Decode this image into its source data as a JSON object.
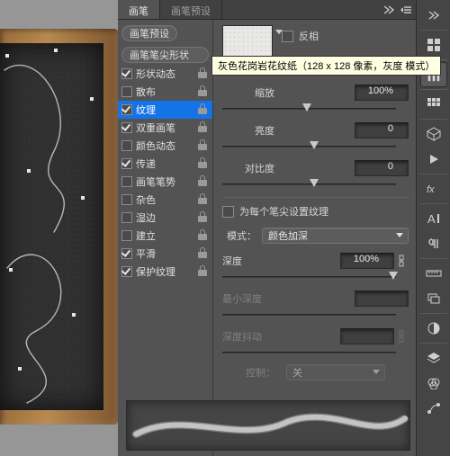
{
  "tabs": {
    "brush": "画笔",
    "presets": "画笔预设"
  },
  "checklist": {
    "preset_btn": "画笔预设",
    "tip_shape": "画笔笔尖形状",
    "items": [
      {
        "label": "形状动态",
        "checked": true,
        "locked": true
      },
      {
        "label": "散布",
        "checked": false,
        "locked": true
      },
      {
        "label": "纹理",
        "checked": true,
        "locked": true,
        "selected": true
      },
      {
        "label": "双重画笔",
        "checked": true,
        "locked": true
      },
      {
        "label": "颜色动态",
        "checked": false,
        "locked": true
      },
      {
        "label": "传递",
        "checked": true,
        "locked": true
      },
      {
        "label": "画笔笔势",
        "checked": false,
        "locked": true
      },
      {
        "label": "杂色",
        "checked": false,
        "locked": true
      },
      {
        "label": "湿边",
        "checked": false,
        "locked": true
      },
      {
        "label": "建立",
        "checked": false,
        "locked": true
      },
      {
        "label": "平滑",
        "checked": true,
        "locked": true
      },
      {
        "label": "保护纹理",
        "checked": true,
        "locked": true
      }
    ]
  },
  "texture": {
    "invert_label": "反相",
    "invert": false,
    "tooltip": "灰色花岗岩花纹纸（128 x 128 像素，灰度 模式）",
    "scale_label": "缩放",
    "scale_value": "100%",
    "brightness_label": "亮度",
    "brightness_value": "0",
    "contrast_label": "对比度",
    "contrast_value": "0",
    "each_tip_label": "为每个笔尖设置纹理",
    "each_tip": false,
    "mode_label": "模式：",
    "mode_value": "颜色加深",
    "depth_label": "深度",
    "depth_value": "100%",
    "min_depth_label": "最小深度",
    "depth_jitter_label": "深度抖动",
    "control_label": "控制：",
    "control_value": "关"
  },
  "rail_icons": [
    "grid",
    "brushes",
    "swatches",
    "cube",
    "play",
    "fx",
    "char-a",
    "paragraph",
    "measure",
    "layers-sm",
    "adjust",
    "layers",
    "channels",
    "paths"
  ]
}
